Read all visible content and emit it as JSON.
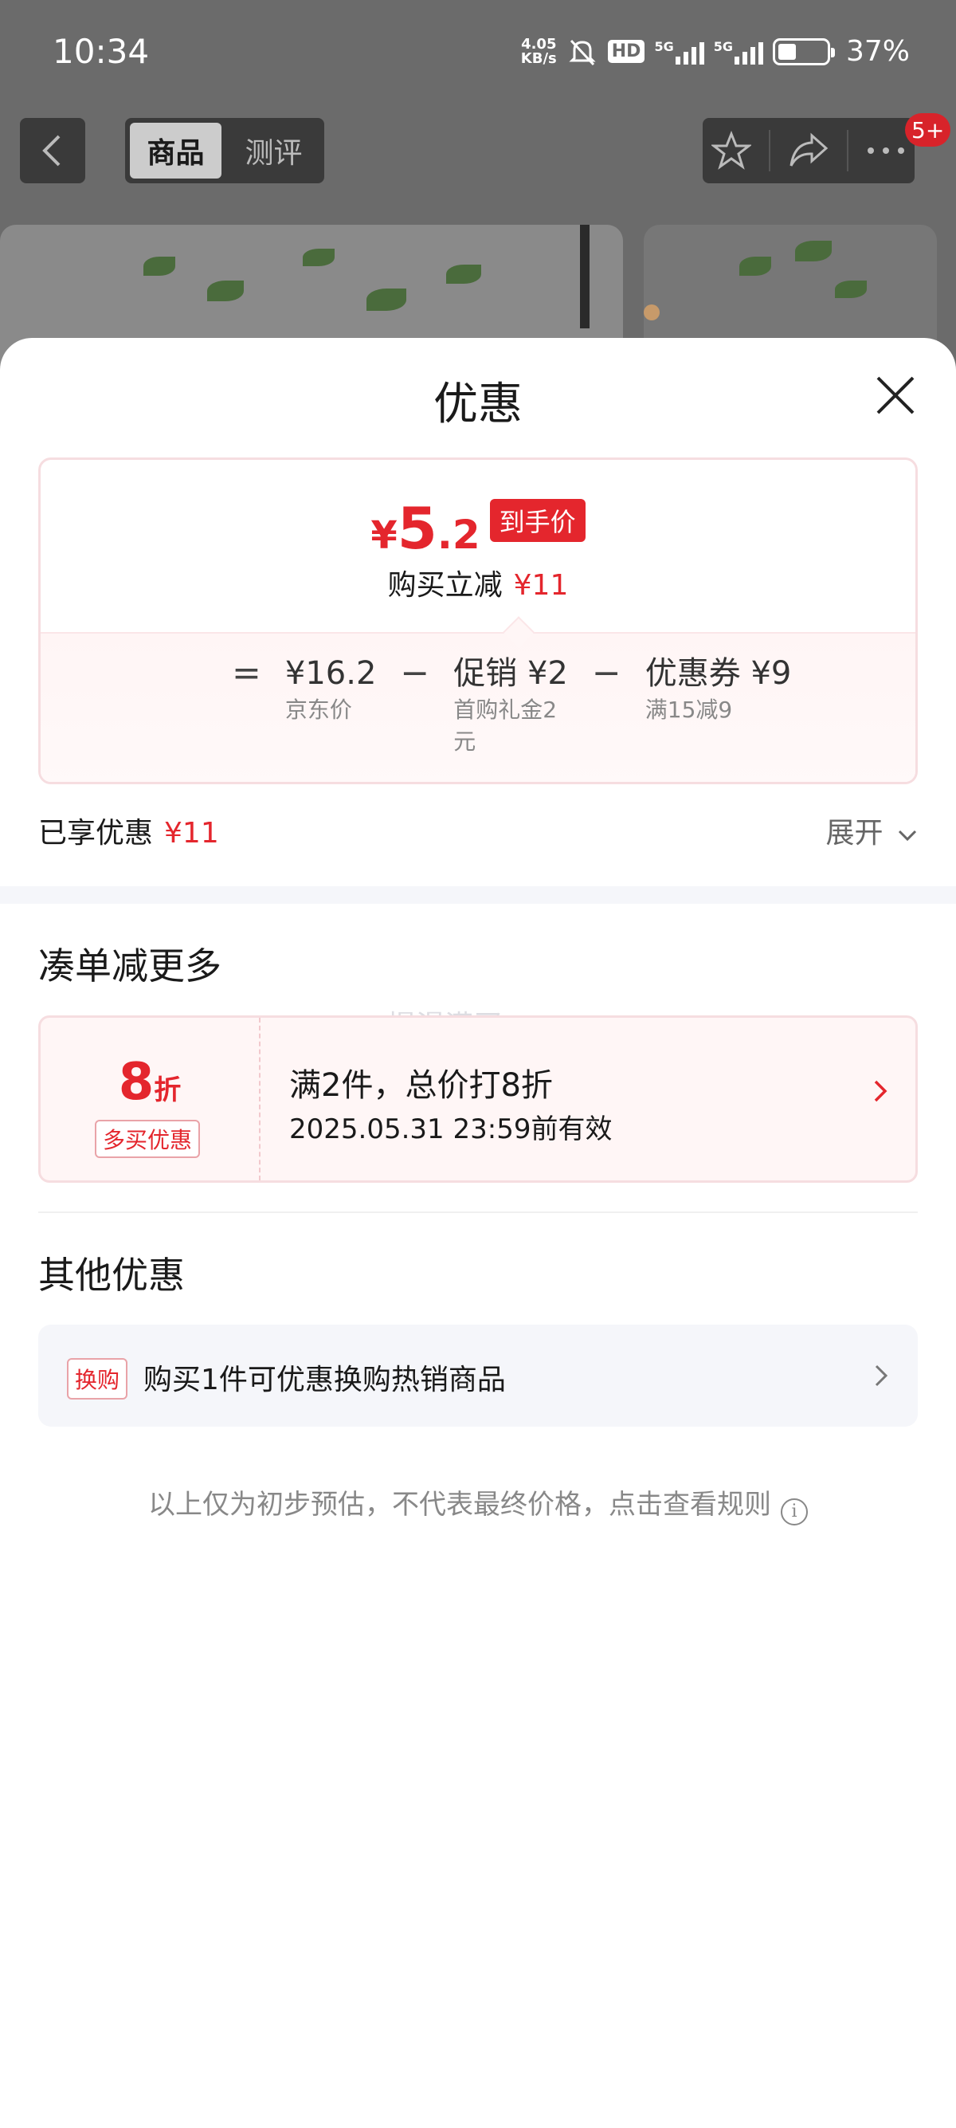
{
  "status_bar": {
    "time": "10:34",
    "net_speed_value": "4.05",
    "net_speed_unit": "KB/s",
    "hd_label": "HD",
    "sim1_label": "5G",
    "sim2_label": "5G",
    "battery": "37%"
  },
  "top_nav": {
    "tabs": [
      {
        "label": "商品"
      },
      {
        "label": "测评"
      }
    ],
    "message_badge": "5+"
  },
  "sheet": {
    "title": "优惠",
    "price_card": {
      "currency": "¥",
      "price_int": "5",
      "price_dec": ".2",
      "price_tag": "到手价",
      "sub_label": "购买立减",
      "sub_value": "¥11",
      "breakdown": {
        "equals": "=",
        "base_value": "¥16.2",
        "base_label": "京东价",
        "minus": "−",
        "promo_value": "促销 ¥2",
        "promo_label": "首购礼金2元",
        "coupon_value": "优惠券 ¥9",
        "coupon_label": "满15减9"
      }
    },
    "enjoyed_label": "已享优惠",
    "enjoyed_value": "¥11",
    "expand_label": "展开",
    "more_section_title": "凑单减更多",
    "more_coupon": {
      "discount_num": "8",
      "discount_unit": "折",
      "tag": "多买优惠",
      "title": "满2件，总价打8折",
      "valid_until": "2025.05.31 23:59前有效"
    },
    "watermark": "慢漫满买",
    "other_section_title": "其他优惠",
    "other_item": {
      "tag": "换购",
      "text": "购买1件可优惠换购热销商品"
    },
    "footnote": "以上仅为初步预估，不代表最终价格，点击查看规则"
  },
  "colors": {
    "accent_red": "#e4262d",
    "card_border": "#f6dde0",
    "band_gray": "#f5f6fa"
  }
}
